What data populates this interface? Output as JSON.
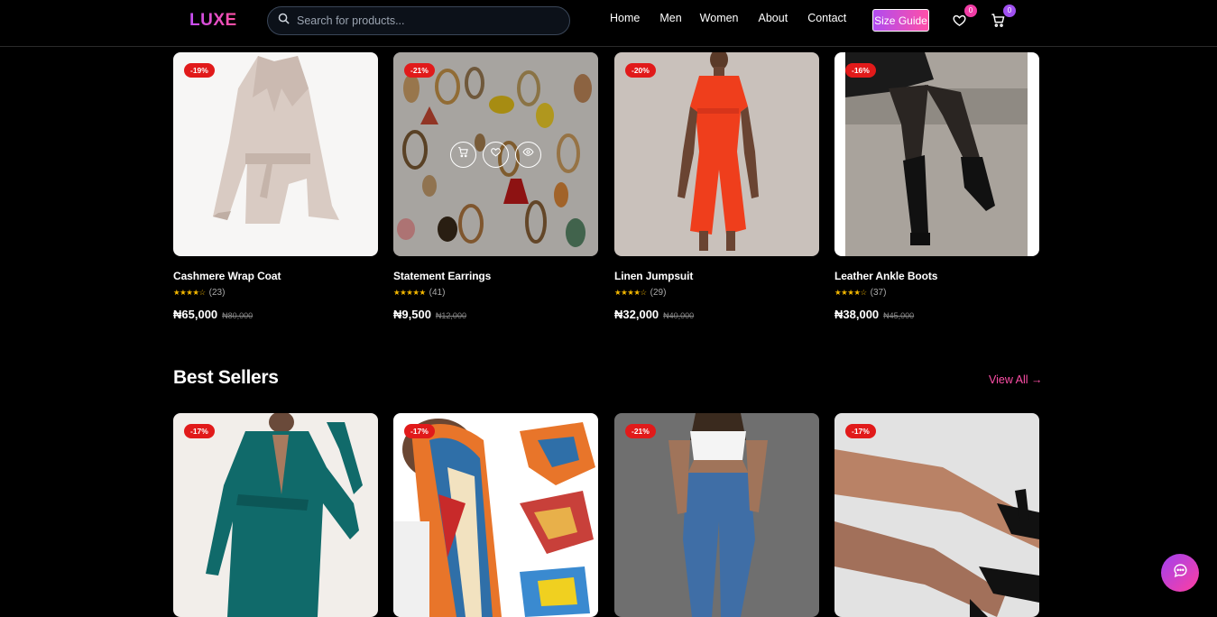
{
  "header": {
    "logo": "LUXE",
    "search_placeholder": "Search for products...",
    "nav": [
      "Home",
      "Men",
      "Women",
      "About",
      "Contact"
    ],
    "size_guide": "Size Guide",
    "wishlist_count": "0",
    "cart_count": "0"
  },
  "row1": [
    {
      "discount": "-19%",
      "name": "Cashmere Wrap Coat",
      "stars": "★★★★☆",
      "reviews": "(23)",
      "price": "₦65,000",
      "old_price": "₦80,000"
    },
    {
      "discount": "-21%",
      "name": "Statement Earrings",
      "stars": "★★★★★",
      "reviews": "(41)",
      "price": "₦9,500",
      "old_price": "₦12,000"
    },
    {
      "discount": "-20%",
      "name": "Linen Jumpsuit",
      "stars": "★★★★☆",
      "reviews": "(29)",
      "price": "₦32,000",
      "old_price": "₦40,000"
    },
    {
      "discount": "-16%",
      "name": "Leather Ankle Boots",
      "stars": "★★★★☆",
      "reviews": "(37)",
      "price": "₦38,000",
      "old_price": "₦45,000"
    }
  ],
  "best_sellers": {
    "title": "Best Sellers",
    "view_all": "View All →",
    "items": [
      {
        "discount": "-17%"
      },
      {
        "discount": "-17%"
      },
      {
        "discount": "-21%"
      },
      {
        "discount": "-17%"
      }
    ]
  },
  "colors": {
    "accent": "#ff4fa8",
    "purple": "#b04cf0",
    "discount": "#e11a1a",
    "star": "#f5b800"
  }
}
